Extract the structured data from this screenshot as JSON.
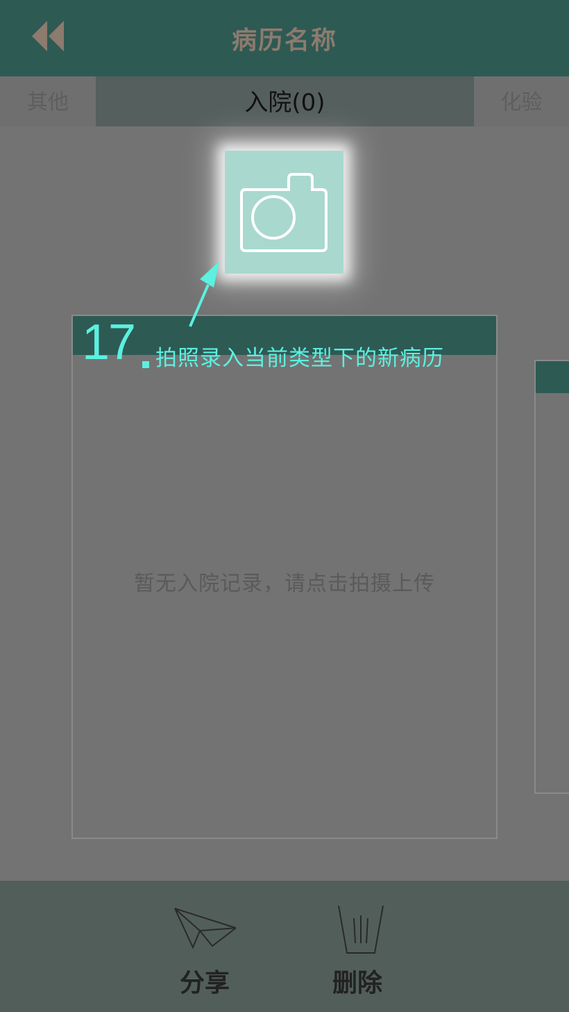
{
  "header": {
    "title": "病历名称",
    "back_icon": "double-chevron-left-icon"
  },
  "tabs": [
    {
      "label": "其他"
    },
    {
      "label": "入院(0)"
    },
    {
      "label": "化验"
    }
  ],
  "camera": {
    "icon": "camera-icon"
  },
  "card": {
    "empty_text": "暂无入院记录，请点击拍摄上传"
  },
  "tutorial": {
    "number": "17",
    "text": "拍照录入当前类型下的新病历"
  },
  "bottom": {
    "share_label": "分享",
    "delete_label": "删除"
  },
  "colors": {
    "header_bg": "#2e5a54",
    "hint": "#5cf0e0",
    "camera_bg": "#a9d8cf"
  }
}
